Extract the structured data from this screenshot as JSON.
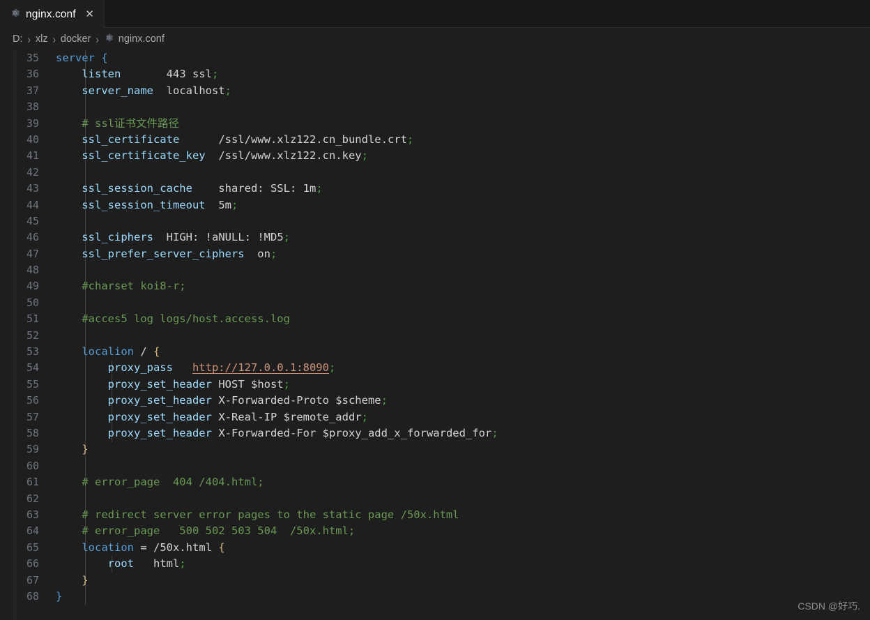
{
  "window": {
    "app": "Visual Studio Code",
    "theme_background": "#1e1e1e"
  },
  "tab": {
    "icon": "gear-icon",
    "label": "nginx.conf",
    "close_label": "✕"
  },
  "breadcrumb": {
    "separator": "›",
    "items": [
      {
        "label": "D:",
        "icon": null
      },
      {
        "label": "xlz",
        "icon": null
      },
      {
        "label": "docker",
        "icon": null
      },
      {
        "label": "nginx.conf",
        "icon": "gear-icon"
      }
    ]
  },
  "editor": {
    "language": "nginx",
    "first_line": 35,
    "last_line": 68,
    "lines": [
      {
        "n": "35",
        "text": "server {"
      },
      {
        "n": "36",
        "text": "    listen       443 ssl;"
      },
      {
        "n": "37",
        "text": "    server_name  localhost;"
      },
      {
        "n": "38",
        "text": ""
      },
      {
        "n": "39",
        "text": "    # ssl证书文件路径"
      },
      {
        "n": "40",
        "text": "    ssl_certificate      /ssl/www.xlz122.cn_bundle.crt;"
      },
      {
        "n": "41",
        "text": "    ssl_certificate_key  /ssl/www.xlz122.cn.key;"
      },
      {
        "n": "42",
        "text": ""
      },
      {
        "n": "43",
        "text": "    ssl_session_cache    shared: SSL: 1m;"
      },
      {
        "n": "44",
        "text": "    ssl_session_timeout  5m;"
      },
      {
        "n": "45",
        "text": ""
      },
      {
        "n": "46",
        "text": "    ssl_ciphers  HIGH: !aNULL: !MD5;"
      },
      {
        "n": "47",
        "text": "    ssl_prefer_server_ciphers  on;"
      },
      {
        "n": "48",
        "text": ""
      },
      {
        "n": "49",
        "text": "    #charset koi8-r;"
      },
      {
        "n": "50",
        "text": ""
      },
      {
        "n": "51",
        "text": "    #acces5 log logs/host.access.log"
      },
      {
        "n": "52",
        "text": ""
      },
      {
        "n": "53",
        "text": "    localion / {"
      },
      {
        "n": "54",
        "text": "        proxy_pass   http://127.0.0.1:8090;"
      },
      {
        "n": "55",
        "text": "        proxy_set_header HOST $host;"
      },
      {
        "n": "56",
        "text": "        proxy_set_header X-Forwarded-Proto $scheme;"
      },
      {
        "n": "57",
        "text": "        proxy_set_header X-Real-IP $remote_addr;"
      },
      {
        "n": "58",
        "text": "        proxy_set_header X-Forwarded-For $proxy_add_x_forwarded_for;"
      },
      {
        "n": "59",
        "text": "    }"
      },
      {
        "n": "60",
        "text": ""
      },
      {
        "n": "61",
        "text": "    # error_page  404 /404.html;"
      },
      {
        "n": "62",
        "text": ""
      },
      {
        "n": "63",
        "text": "    # redirect server error pages to the static page /50x.html"
      },
      {
        "n": "64",
        "text": "    # error_page   500 502 503 504  /50x.html;"
      },
      {
        "n": "65",
        "text": "    location = /50x.html {"
      },
      {
        "n": "66",
        "text": "        root   html;"
      },
      {
        "n": "67",
        "text": "    }"
      },
      {
        "n": "68",
        "text": "}"
      }
    ]
  },
  "watermark": {
    "text": "CSDN @好巧."
  },
  "colors": {
    "background": "#1e1e1e",
    "tabbar_background": "#181818",
    "tab_active_background": "#1f1f1f",
    "line_number": "#6e7681",
    "foreground": "#d4d4d4",
    "keyword": "#569cd6",
    "directive": "#9cdcfe",
    "string": "#ce9178",
    "comment": "#6a9955",
    "brace_yellow": "#d7ba7d",
    "brace_blue": "#569cd6",
    "number": "#b5cea8"
  }
}
